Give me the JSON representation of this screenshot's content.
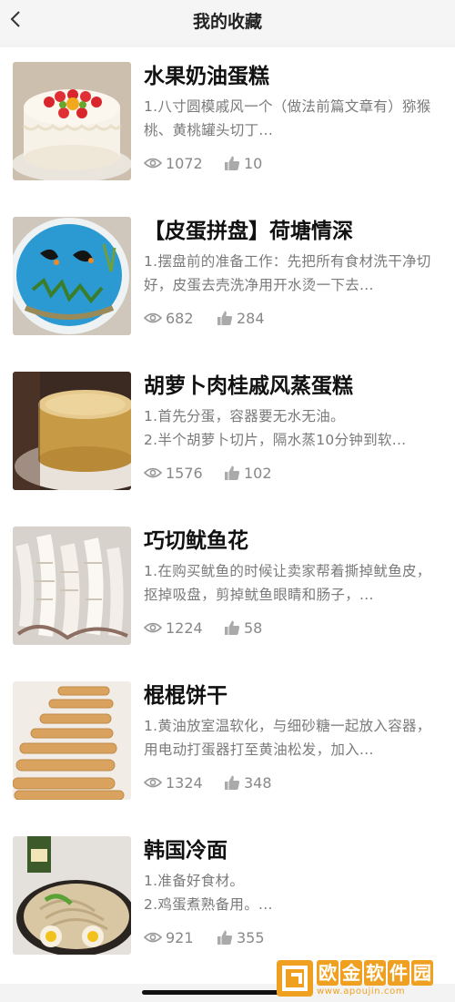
{
  "header": {
    "title": "我的收藏"
  },
  "items": [
    {
      "name": "水果奶油蛋糕",
      "desc": "1.八寸圆模戚风一个（做法前篇文章有）猕猴桃、黄桃罐头切丁...",
      "views": "1072",
      "likes": "10"
    },
    {
      "name": "【皮蛋拼盘】荷塘情深",
      "desc": "1.摆盘前的准备工作：先把所有食材洗干净切好，皮蛋去壳洗净用开水烫一下去...",
      "views": "682",
      "likes": "284"
    },
    {
      "name": "胡萝卜肉桂戚风蒸蛋糕",
      "desc": "1.首先分蛋，容器要无水无油。\n2.半个胡萝卜切片，隔水蒸10分钟到软...",
      "views": "1576",
      "likes": "102"
    },
    {
      "name": "巧切鱿鱼花",
      "desc": "1.在购买鱿鱼的时候让卖家帮着撕掉鱿鱼皮，抠掉吸盘，剪掉鱿鱼眼睛和肠子，...",
      "views": "1224",
      "likes": "58"
    },
    {
      "name": "棍棍饼干",
      "desc": "1.黄油放室温软化，与细砂糖一起放入容器，用电动打蛋器打至黄油松发，加入...",
      "views": "1324",
      "likes": "348"
    },
    {
      "name": "韩国冷面",
      "desc": "1.准备好食材。\n2.鸡蛋煮熟备用。...",
      "views": "921",
      "likes": "355"
    }
  ],
  "watermark": {
    "cn": [
      "欧",
      "金",
      "软",
      "件",
      "园"
    ],
    "url": "www.apoujin.com"
  },
  "icons": {
    "back": "chevron-left-icon",
    "view": "eye-icon",
    "like": "thumbs-up-icon"
  },
  "colors": {
    "accent": "#f0a020",
    "muted": "#888888"
  }
}
